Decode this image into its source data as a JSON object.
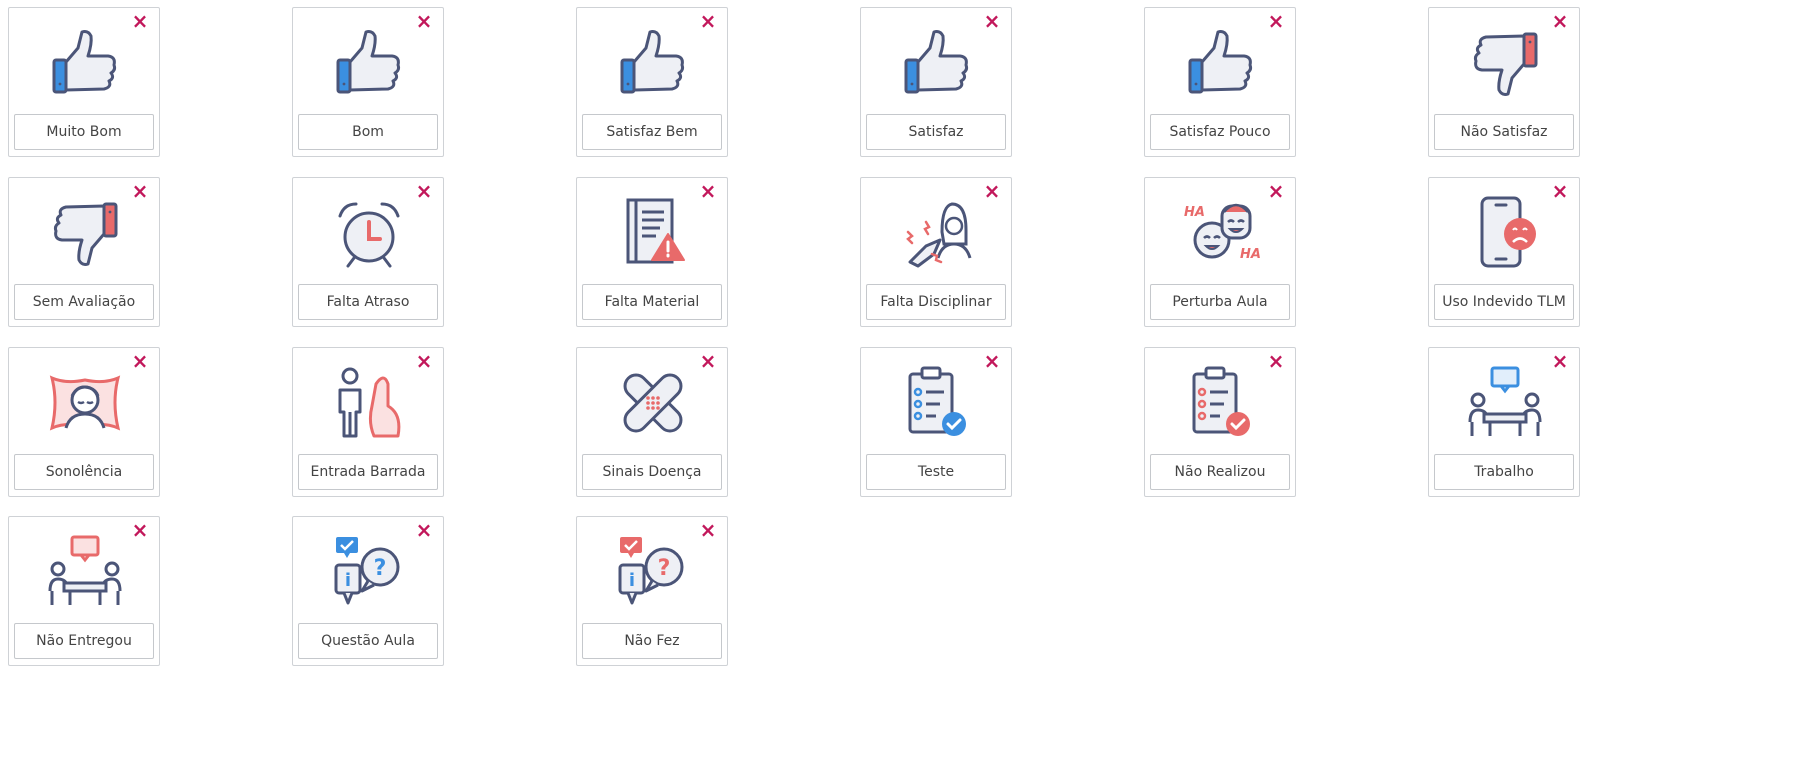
{
  "colors": {
    "outline": "#4b5578",
    "blue": "#3b8fe0",
    "red": "#e86a6a",
    "pink": "#f29a9a",
    "remove": "#c2185b",
    "card_border": "#cfd2d6"
  },
  "remove_glyph": "×",
  "cards": [
    {
      "label": "Muito Bom",
      "icon": "thumbs-up-icon"
    },
    {
      "label": "Bom",
      "icon": "thumbs-up-icon"
    },
    {
      "label": "Satisfaz Bem",
      "icon": "thumbs-up-icon"
    },
    {
      "label": "Satisfaz",
      "icon": "thumbs-up-icon"
    },
    {
      "label": "Satisfaz Pouco",
      "icon": "thumbs-up-icon"
    },
    {
      "label": "Não Satisfaz",
      "icon": "thumbs-down-icon"
    },
    {
      "label": "Sem Avaliação",
      "icon": "thumbs-down-icon"
    },
    {
      "label": "Falta Atraso",
      "icon": "alarm-clock-icon"
    },
    {
      "label": "Falta Material",
      "icon": "notebook-warning-icon"
    },
    {
      "label": "Falta Disciplinar",
      "icon": "angry-student-icon"
    },
    {
      "label": "Perturba Aula",
      "icon": "laughing-faces-icon"
    },
    {
      "label": "Uso Indevido TLM",
      "icon": "sad-phone-icon"
    },
    {
      "label": "Sonolência",
      "icon": "sleepy-face-pillow-icon"
    },
    {
      "label": "Entrada Barrada",
      "icon": "stop-hand-person-icon"
    },
    {
      "label": "Sinais Doença",
      "icon": "bandage-icon"
    },
    {
      "label": "Teste",
      "icon": "checklist-check-icon"
    },
    {
      "label": "Não Realizou",
      "icon": "checklist-cross-icon"
    },
    {
      "label": "Trabalho",
      "icon": "meeting-blue-icon"
    },
    {
      "label": "Não Entregou",
      "icon": "meeting-red-icon"
    },
    {
      "label": "Questão Aula",
      "icon": "question-chat-blue-icon"
    },
    {
      "label": "Não Fez",
      "icon": "question-chat-red-icon"
    }
  ]
}
